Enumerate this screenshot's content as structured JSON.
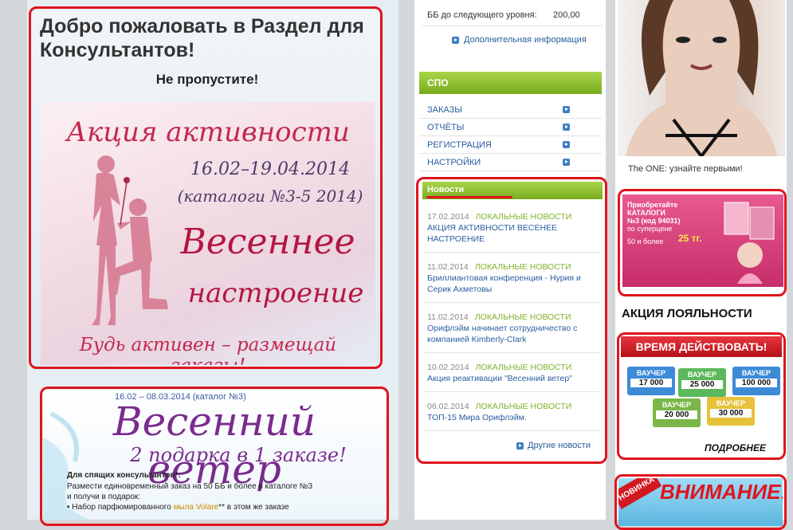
{
  "welcome": {
    "title": "Добро пожаловать в Раздел для Консультантов!",
    "subtitle": "Не пропустите!"
  },
  "banner_activity": {
    "title": "Акция активности",
    "dates": "16.02–19.04.2014",
    "catalogs": "(каталоги №3-5 2014)",
    "big_line1": "Весеннее",
    "big_line2": "настроение",
    "footer": "Будь активен – размещай заказы!"
  },
  "banner_wind": {
    "dates": "16.02 – 08.03.2014 (каталог №3)",
    "title": "Весенний ветер",
    "subtitle": "2 подарка в 1 заказе!",
    "line1": "Для спящих консультантов*:",
    "line2": "Размести единовременный заказ на 50 ББ и более в каталоге №3",
    "line3": "и получи в подарок:",
    "line4_prefix": "• Набор парфюмированного",
    "line4_highlight": "мыла Volare",
    "line4_suffix": "** в этом же заказе"
  },
  "account": {
    "bb_label": "ББ до следующего уровня:",
    "bb_value": "200,00",
    "more_info": "Дополнительная информация"
  },
  "spo": {
    "header": "СПО",
    "items": [
      "ЗАКАЗЫ",
      "ОТЧЁТЫ",
      "РЕГИСТРАЦИЯ",
      "НАСТРОЙКИ"
    ]
  },
  "news": {
    "header": "Новости",
    "items": [
      {
        "date": "17.02.2014",
        "category": "ЛОКАЛЬНЫЕ НОВОСТИ",
        "title": "АКЦИЯ АКТИВНОСТИ ВЕСЕНЕЕ НАСТРОЕНИЕ"
      },
      {
        "date": "11.02.2014",
        "category": "ЛОКАЛЬНЫЕ НОВОСТИ",
        "title": "Бриллиантовая конференция - Нурия и Серик Ахметовы"
      },
      {
        "date": "11.02.2014",
        "category": "ЛОКАЛЬНЫЕ НОВОСТИ",
        "title": "Орифлэйм начинает сотрудничество с компанией Kimberly-Clark"
      },
      {
        "date": "10.02.2014",
        "category": "ЛОКАЛЬНЫЕ НОВОСТИ",
        "title": "Акция реактивации \"Весенний ветер\""
      },
      {
        "date": "06.02.2014",
        "category": "ЛОКАЛЬНЫЕ НОВОСТИ",
        "title": "ТОП-15 Мира Орифлэйм."
      }
    ],
    "other_news": "Другие новости"
  },
  "promo": {
    "the_one": "The ONE: узнайте первыми!",
    "catalog_lines": [
      "Приобретайте",
      "КАТАЛОГИ",
      "№3 (код 94031)",
      "по суперцене",
      "50 и более",
      "25 тг."
    ],
    "loyalty": "АКЦИЯ ЛОЯЛЬНОСТИ",
    "act_now": "ВРЕМЯ ДЕЙСТВОВАТЬ!",
    "voucher_label": "ВАУЧЕР",
    "voucher_values": [
      "17 000",
      "25 000",
      "100 000",
      "20 000",
      "30 000"
    ],
    "more": "ПОДРОБНЕЕ",
    "new_tag": "НОВИНКА",
    "attention": "ВНИМАНИЕ!"
  },
  "colors": {
    "accent_red": "#e0141e",
    "green_bar": "#8cc236",
    "link_blue": "#2a5d9f"
  }
}
